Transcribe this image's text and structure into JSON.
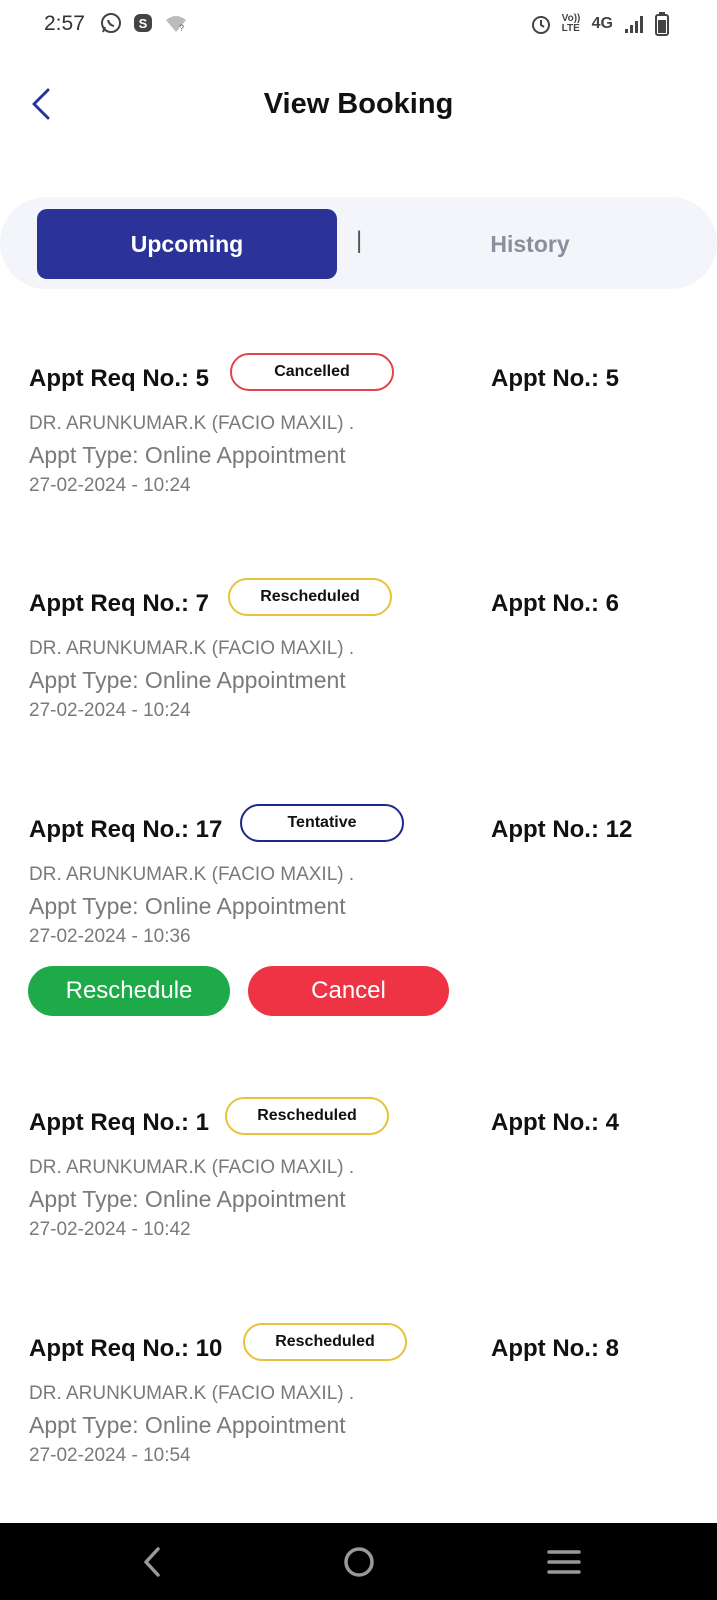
{
  "status_bar": {
    "time": "2:57",
    "network": "4G",
    "volte": "Vo)) LTE"
  },
  "header": {
    "title": "View Booking"
  },
  "tabs": {
    "upcoming": "Upcoming",
    "divider": "|",
    "history": "History"
  },
  "colors": {
    "primary": "#2b3399",
    "cancelled": "#e0454f",
    "rescheduled": "#e8c23a",
    "tentative": "#1c2a8a",
    "reschedule_button": "#1faa4a",
    "cancel_button": "#ee3344"
  },
  "bookings": [
    {
      "req_no": "Appt Req No.: 5",
      "status": "Cancelled",
      "status_color": "#e0454f",
      "appt_no": "Appt No.: 5",
      "doctor": "DR. ARUNKUMAR.K (FACIO MAXIL) .",
      "appt_type": "Appt Type: Online Appointment",
      "datetime": "27-02-2024 - 10:24"
    },
    {
      "req_no": "Appt Req No.: 7",
      "status": "Rescheduled",
      "status_color": "#e8c23a",
      "appt_no": "Appt No.: 6",
      "doctor": "DR. ARUNKUMAR.K (FACIO MAXIL) .",
      "appt_type": "Appt Type: Online Appointment",
      "datetime": "27-02-2024 - 10:24"
    },
    {
      "req_no": "Appt Req No.: 17",
      "status": "Tentative",
      "status_color": "#1c2a8a",
      "appt_no": "Appt No.: 12",
      "doctor": "DR. ARUNKUMAR.K (FACIO MAXIL) .",
      "appt_type": "Appt Type: Online Appointment",
      "datetime": "27-02-2024 - 10:36",
      "reschedule_label": "Reschedule",
      "cancel_label": "Cancel"
    },
    {
      "req_no": "Appt Req No.: 1",
      "status": "Rescheduled",
      "status_color": "#e8c23a",
      "appt_no": "Appt No.: 4",
      "doctor": "DR. ARUNKUMAR.K (FACIO MAXIL) .",
      "appt_type": "Appt Type: Online Appointment",
      "datetime": "27-02-2024 - 10:42"
    },
    {
      "req_no": "Appt Req No.: 10",
      "status": "Rescheduled",
      "status_color": "#e8c23a",
      "appt_no": "Appt No.: 8",
      "doctor": "DR. ARUNKUMAR.K (FACIO MAXIL) .",
      "appt_type": "Appt Type: Online Appointment",
      "datetime": "27-02-2024 - 10:54"
    }
  ],
  "icons": {
    "back": "back-arrow-icon",
    "nav_back": "nav-back-icon",
    "nav_home": "nav-home-icon",
    "nav_menu": "nav-menu-icon"
  }
}
